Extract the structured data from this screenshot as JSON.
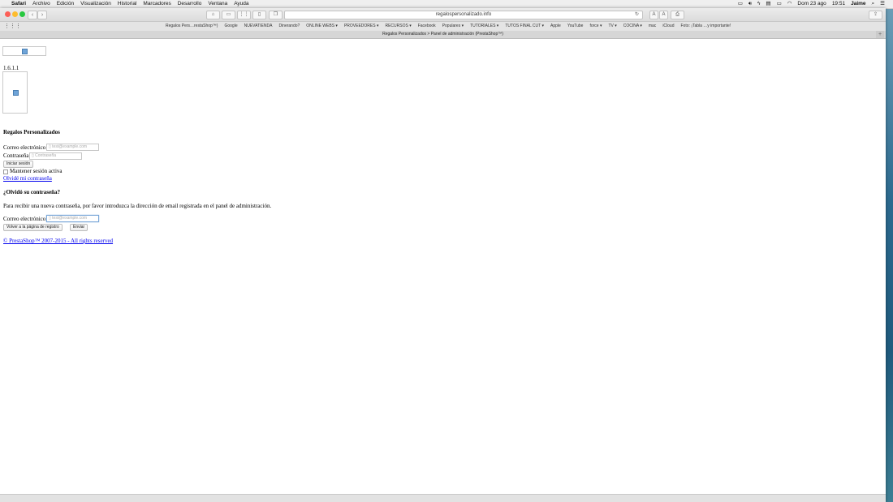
{
  "menubar": {
    "items": [
      "Safari",
      "Archivo",
      "Edición",
      "Visualización",
      "Historial",
      "Marcadores",
      "Desarrollo",
      "Ventana",
      "Ayuda"
    ],
    "date": "Dom 23 ago",
    "time": "19:51",
    "user": "Jaime"
  },
  "browser": {
    "address": "regalospersonalizado.info",
    "tab_title": "Regalos Personalizados > Panel de administración (PrestaShop™)",
    "bookmarks": [
      "Regalos Pers…restaShop™)",
      "Google",
      "NUEVATIENDA",
      "Dinerando?",
      "ONLINE WEBS ▾",
      "PROVEEDORES ▾",
      "RECURSOS ▾",
      "Facebook",
      "Populares ▾",
      "TUTORIALES ▾",
      "TUTOS FINAL CUT ▾",
      "Apple",
      "YouTube",
      "force ▾",
      "TV ▾",
      "COCINA ▾",
      "mac",
      "iCloud",
      "Foto: ¡Tabla …y importante!"
    ],
    "text_small": "A",
    "text_large": "A"
  },
  "page": {
    "version": "1.6.1.1",
    "shop_name": "Regalos Personalizados",
    "login": {
      "email_label": "Correo electrónico",
      "email_placeholder": "test@example.com",
      "password_label": "Contraseña",
      "password_placeholder": "Contraseña",
      "submit_label": "Iniciar sesión",
      "stay_logged_label": "Mantener sesión activa",
      "forgot_link": "Olvidé mi contraseña"
    },
    "forgot": {
      "title": "¿Olvidó su contraseña?",
      "description": "Para recibir una nueva contraseña, por favor introduzca la dirección de email registrada en el panel de administración.",
      "email_label": "Correo electrónico",
      "email_placeholder": "test@example.com",
      "back_label": "Volver a la página de registro",
      "send_label": "Enviar"
    },
    "footer": "© PrestaShop™ 2007-2015 - All rights reserved"
  }
}
